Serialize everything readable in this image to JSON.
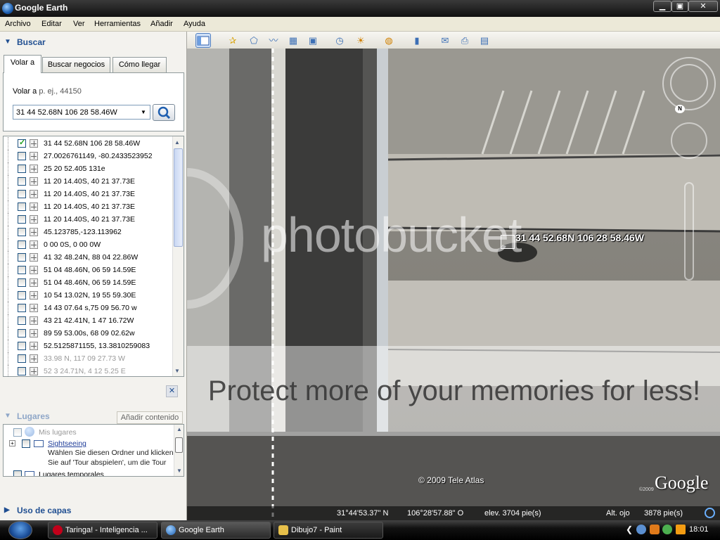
{
  "window": {
    "title": "Google Earth",
    "min": "▁",
    "max": "▣",
    "close": "✕"
  },
  "menu": [
    "Archivo",
    "Editar",
    "Ver",
    "Herramientas",
    "Añadir",
    "Ayuda"
  ],
  "search_panel": {
    "header": "Buscar",
    "tabs": [
      "Volar a",
      "Buscar negocios",
      "Cómo llegar"
    ],
    "fly_label": "Volar a",
    "fly_example": "p. ej., 44150",
    "fly_value": "31 44 52.68N 106 28 58.46W",
    "results": [
      "31 44 52.68N 106 28 58.46W",
      "27.0026761149, -80.2433523952",
      "25 20 52.405 131e",
      "11 20 14.40S, 40 21 37.73E",
      "11 20 14.40S, 40 21 37.73E",
      "11 20 14.40S, 40 21 37.73E",
      "11 20 14.40S, 40 21 37.73E",
      "45.123785,-123.113962",
      "0 00 0S, 0 00 0W",
      "41 32 48.24N, 88 04 22.86W",
      "51 04 48.46N, 06 59 14.59E",
      "51 04 48.46N, 06 59 14.59E",
      "10 54 13.02N, 19 55 59.30E",
      "14 43 07.64 s,75 09 56.70 w",
      "43 21 42.41N, 1 47 16.72W",
      "89 59 53.00s, 68 09 02.62w",
      "52.5125871155, 13.3810259083",
      "33.98 N, 117 09 27.73 W",
      "52 3 24.71N, 4 12 5.25 E"
    ]
  },
  "places_panel": {
    "header": "Lugares",
    "add_content": "Añadir contenido",
    "my_places": "Mis lugares",
    "sightseeing": "Sightseeing",
    "sightseeing_desc_1": "Wählen Sie diesen Ordner und klicken",
    "sightseeing_desc_2": "Sie auf 'Tour abspielen', um die Tour",
    "temp_places": "Lugares temporales"
  },
  "layers_panel": {
    "header": "Uso de capas"
  },
  "map": {
    "placemark_label": "31 44 52.68N 106 28 58.46W",
    "watermark": "photobucket",
    "banner": "Protect more of your memories for less!",
    "copyright": "© 2009 Tele Atlas",
    "logo": "Google",
    "logo_year": "©2009",
    "compass_north": "N"
  },
  "status": {
    "lat": "31°44'53.37\" N",
    "lon": "106°28'57.88\" O",
    "elev": "elev.  3704 pie(s)",
    "eye_label": "Alt. ojo",
    "eye_value": "3878 pie(s)"
  },
  "taskbar": {
    "tasks": [
      "Taringa! - Inteligencia ...",
      "Google Earth",
      "Dibujo7 - Paint"
    ],
    "clock": "18:01",
    "tray_arrow": "❮"
  },
  "colors": {
    "panel_header": "#1f4e91",
    "taskbar": "#000000",
    "titlebar": "#1a1a1a"
  }
}
